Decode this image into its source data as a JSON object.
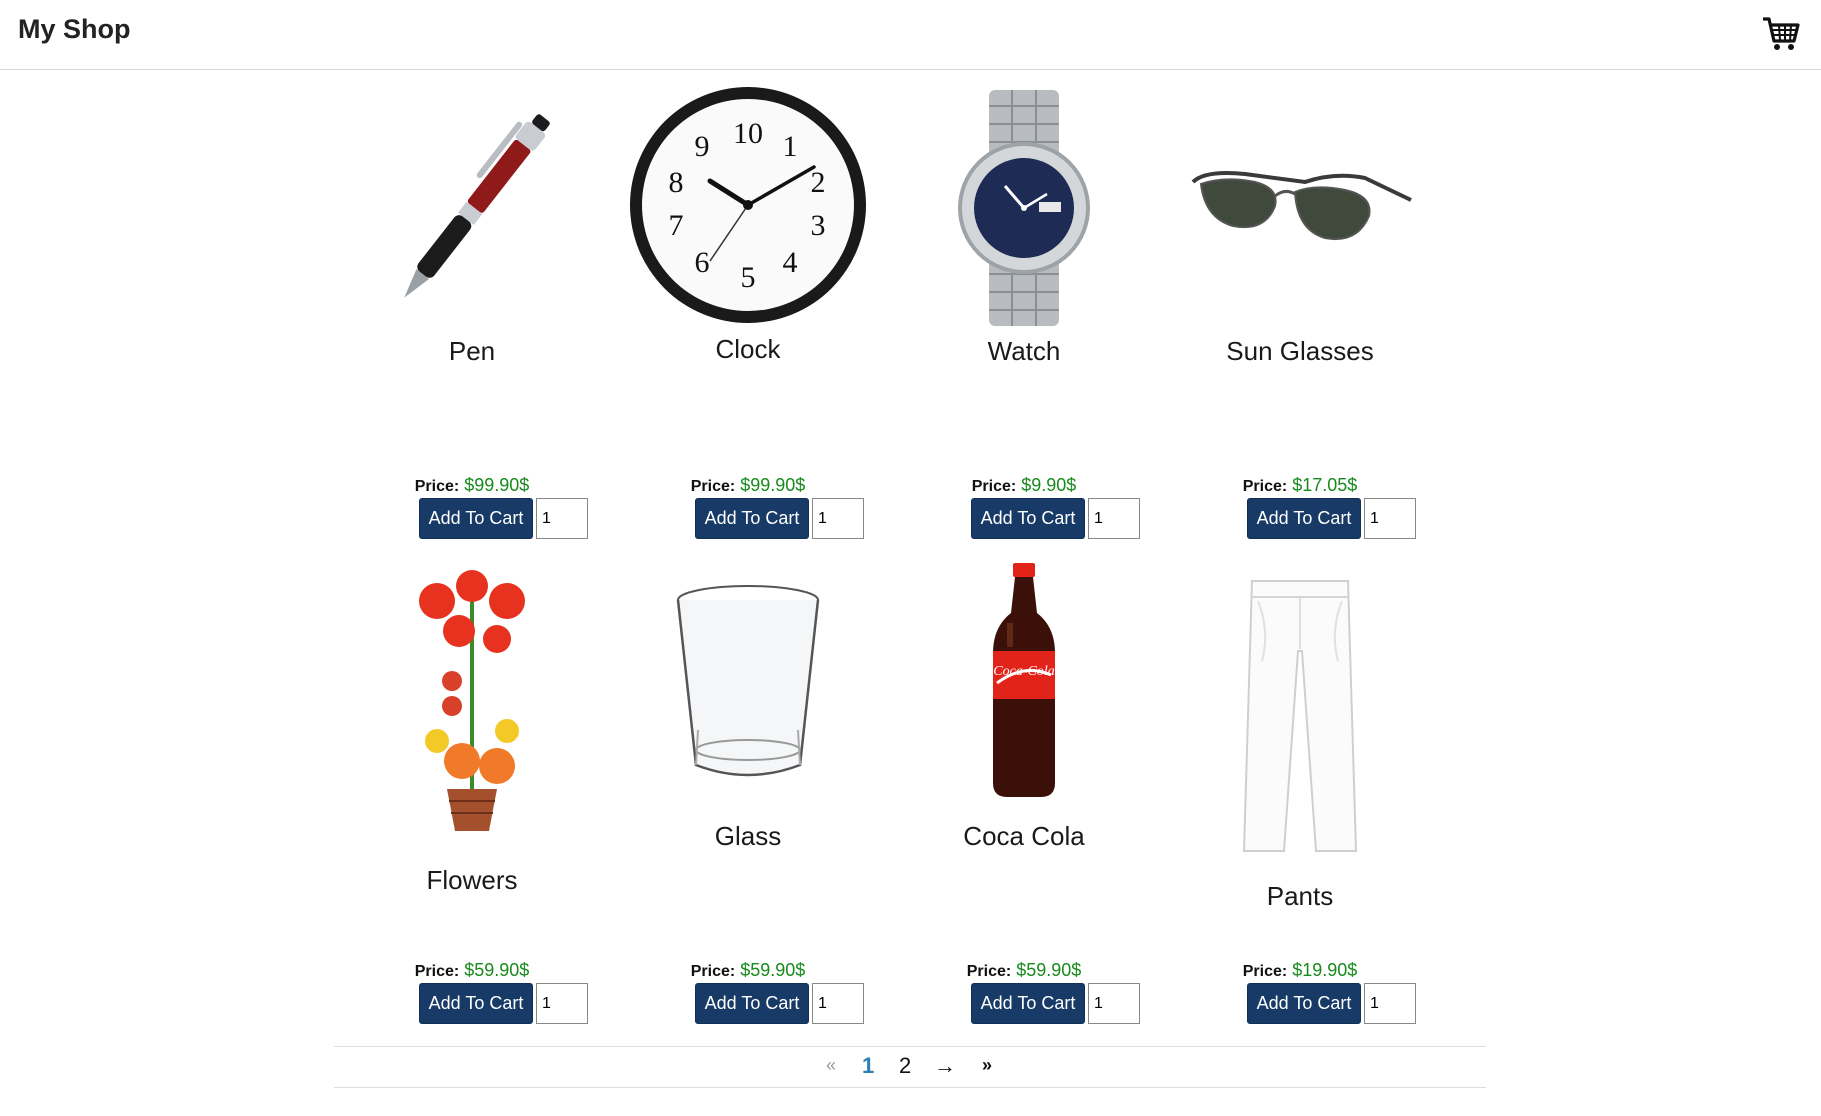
{
  "header": {
    "brand": "My Shop",
    "cart_icon": "shopping-cart-icon"
  },
  "common": {
    "price_label": "Price:",
    "add_to_cart_label": "Add To Cart"
  },
  "products": [
    {
      "name": "Pen",
      "price": "$99.90$",
      "qty": "1"
    },
    {
      "name": "Clock",
      "price": "$99.90$",
      "qty": "1"
    },
    {
      "name": "Watch",
      "price": "$9.90$",
      "qty": "1"
    },
    {
      "name": "Sun Glasses",
      "price": "$17.05$",
      "qty": "1"
    },
    {
      "name": "Flowers",
      "price": "$59.90$",
      "qty": "1"
    },
    {
      "name": "Glass",
      "price": "$59.90$",
      "qty": "1"
    },
    {
      "name": "Coca Cola",
      "price": "$59.90$",
      "qty": "1"
    },
    {
      "name": "Pants",
      "price": "$19.90$",
      "qty": "1"
    }
  ],
  "pagination": {
    "first": "«",
    "pages": [
      "1",
      "2"
    ],
    "current": "1",
    "next": "→",
    "last": "»"
  },
  "colors": {
    "button": "#173a66",
    "price": "#178a1c",
    "active_page": "#2e7fb3"
  }
}
